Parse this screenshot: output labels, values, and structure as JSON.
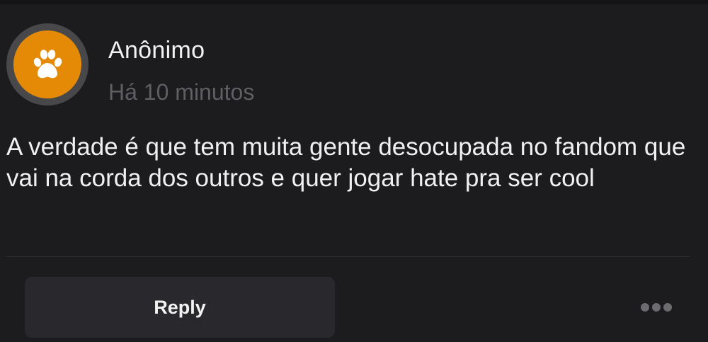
{
  "comment": {
    "author": "Anônimo",
    "time": "Há 10 minutos",
    "text": "A verdade é que tem muita gente desocupada no fandom que vai na corda dos outros e quer jogar hate pra ser cool",
    "avatar_icon": "paw-icon"
  },
  "actions": {
    "reply_label": "Reply",
    "more_icon": "more-horizontal-icon"
  },
  "colors": {
    "background": "#1c1c1f",
    "avatar": "#e48a07",
    "avatar_ring": "#48484b",
    "button": "#29292d",
    "muted_text": "#5f5f63"
  }
}
